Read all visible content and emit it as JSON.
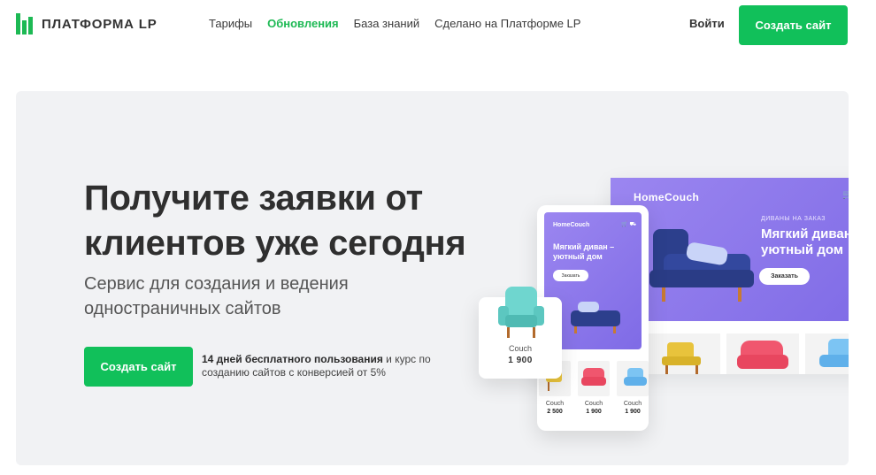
{
  "header": {
    "logo_text": "ПЛАТФОРМА LP",
    "nav": [
      {
        "label": "Тарифы",
        "active": false
      },
      {
        "label": "Обновления",
        "active": true
      },
      {
        "label": "База знаний",
        "active": false
      },
      {
        "label": "Сделано на Платформе LP",
        "active": false
      }
    ],
    "login_label": "Войти",
    "cta_label": "Создать сайт"
  },
  "hero": {
    "title": "Получите заявки от клиентов уже сегодня",
    "subtitle": "Сервис для создания и ведения одностраничных сайтов",
    "cta_label": "Создать сайт",
    "note_bold": "14 дней бесплатного пользования",
    "note_rest": " и курс по созданию сайтов с конверсией от 5%"
  },
  "mockup_desktop": {
    "brand": "HomeCouch",
    "tag": "ДИВАНЫ НА ЗАКАЗ",
    "headline": "Мягкий диван – уютный дом",
    "order_label": "Заказать"
  },
  "mockup_phone": {
    "brand": "HomeCouch",
    "headline": "Мягкий диван – уютный дом",
    "order_label": "Заказать",
    "products": [
      {
        "name": "Couch",
        "price": "2 500"
      },
      {
        "name": "Couch",
        "price": "1 900"
      },
      {
        "name": "Couch",
        "price": "1 900"
      }
    ]
  },
  "mockup_card": {
    "name": "Couch",
    "price": "1 900"
  },
  "colors": {
    "accent": "#11c05a",
    "logo": "#1db954",
    "hero_bg": "#f1f2f4",
    "purple": "#8b76ea"
  },
  "icons": [
    "logo-bars-icon",
    "cart-icon",
    "truck-icon",
    "sofa-icon",
    "armchair-icon"
  ]
}
